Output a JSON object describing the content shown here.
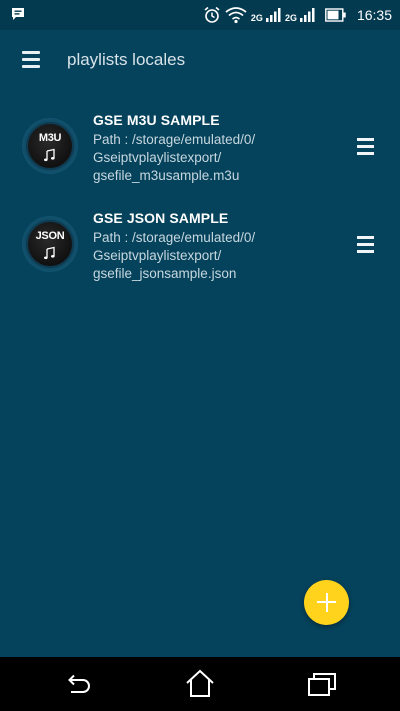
{
  "status_bar": {
    "time": "16:35",
    "network_1": "2G",
    "network_2": "2G",
    "icons": [
      "message-icon",
      "alarm-icon",
      "wifi-icon",
      "signal-icon",
      "signal-icon",
      "battery-icon"
    ]
  },
  "app_bar": {
    "title": "playlists locales",
    "menu_icon": "hamburger-menu-icon"
  },
  "playlists": [
    {
      "badge": "M3U",
      "title": "GSE M3U SAMPLE",
      "path_lines": [
        "Path : /storage/emulated/0/",
        "Gseiptvplaylistexport/",
        "gsefile_m3usample.m3u"
      ]
    },
    {
      "badge": "JSON",
      "title": "GSE JSON SAMPLE",
      "path_lines": [
        "Path : /storage/emulated/0/",
        "Gseiptvplaylistexport/",
        "gsefile_jsonsample.json"
      ]
    }
  ],
  "fab": {
    "icon": "plus-icon",
    "color": "#ffd21c"
  },
  "colors": {
    "background": "#05425b",
    "accent": "#ffd21c"
  },
  "nav_bar": {
    "buttons": [
      "back-icon",
      "home-icon",
      "recent-apps-icon"
    ]
  }
}
